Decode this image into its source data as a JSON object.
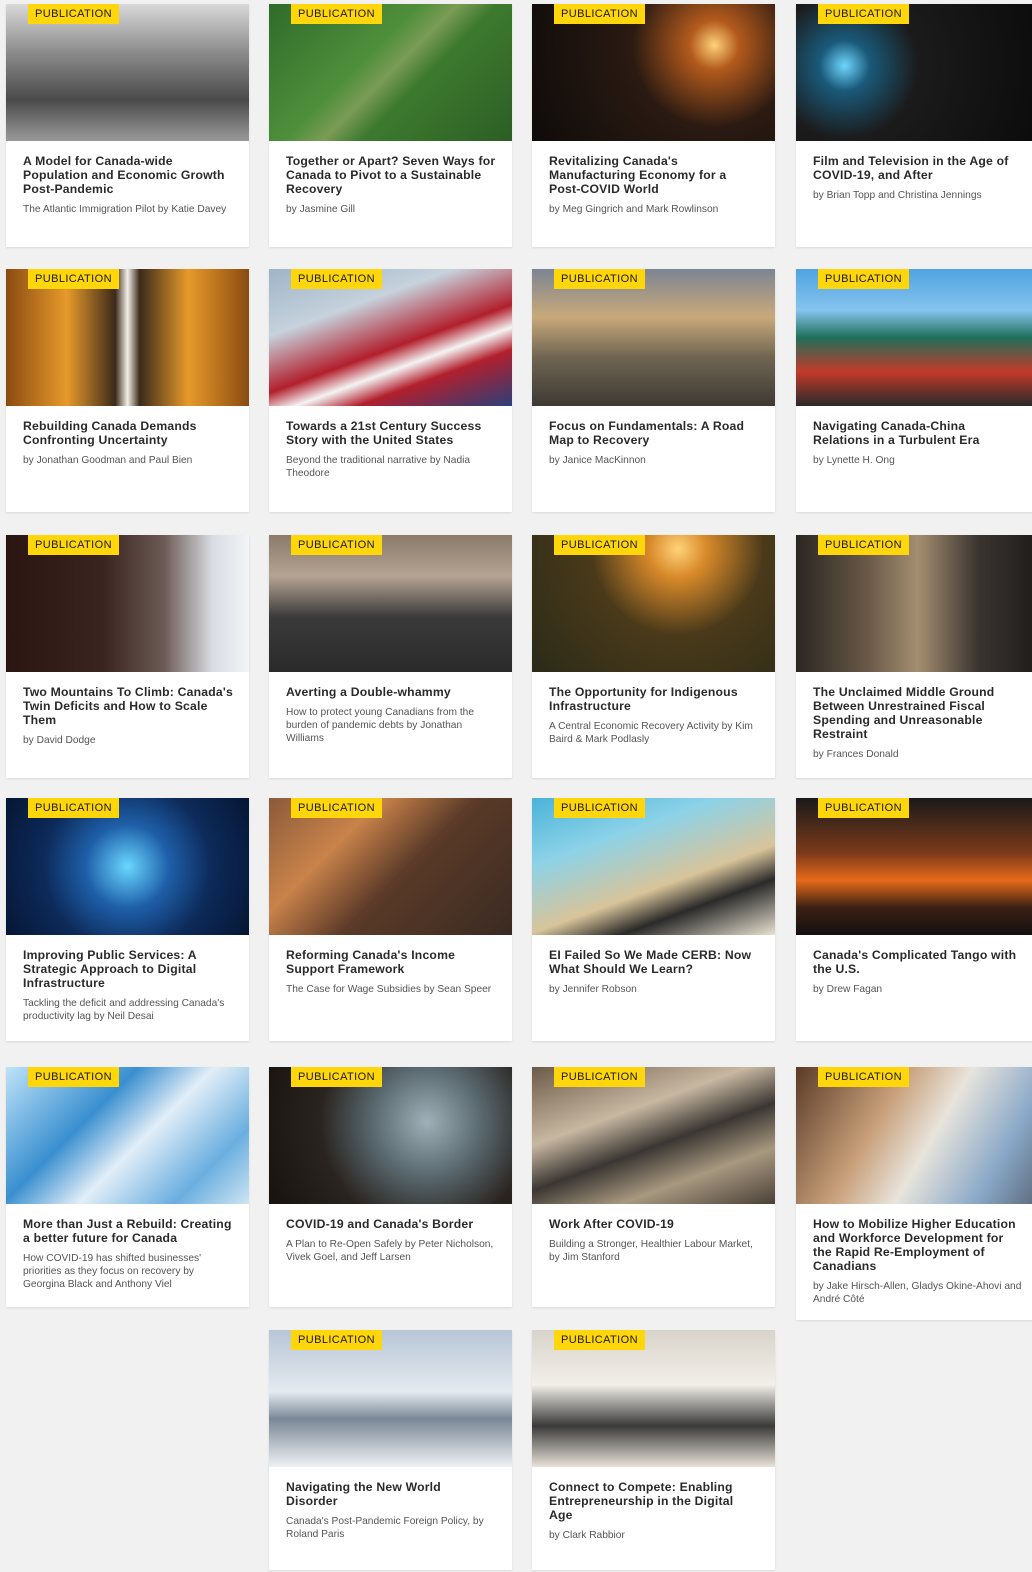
{
  "badge_label": "PUBLICATION",
  "cards": [
    {
      "title": "A Model for Canada-wide Population and Economic Growth Post-Pandemic",
      "sub": "The Atlantic Immigration Pilot by Katie Davey",
      "bg": "linear-gradient(180deg,#d9d9d9 0%,#8c8c8c 35%,#4a4a4a 70%,#9a9a9a 100%)"
    },
    {
      "title": "Together or Apart? Seven Ways for Canada to Pivot to a Sustainable Recovery",
      "sub": "by Jasmine Gill",
      "bg": "linear-gradient(135deg,#2f6b2a 0%,#4f8f3b 40%,#7a9b56 50%,#3d7a2e 60%,#2c5e25 100%)"
    },
    {
      "title": "Revitalizing Canada's Manufacturing Economy for a Post-COVID World",
      "sub": "by Meg Gingrich and Mark Rowlinson",
      "bg": "radial-gradient(circle at 75% 30%,#ffd27a 0%,#b35a1c 12%,#2a1a12 40%,#0e0b0a 100%)"
    },
    {
      "title": "Film and Television in the Age of COVID-19, and After",
      "sub": "by Brian Topp and Christina Jennings",
      "bg": "radial-gradient(circle at 20% 45%,#6fd6ff 0%,#1a5a7a 12%,#1b1b1b 35%,#0b0b0b 100%)"
    },
    {
      "title": "Rebuilding Canada Demands Confronting Uncertainty",
      "sub": "by Jonathan Goodman and Paul Bien",
      "bg": "linear-gradient(90deg,#8a4b12 0%,#e79a2a 25%,#3b2a1a 45%,#f3efe6 50%,#3b2a1a 55%,#e79a2a 75%,#8a4b12 100%)"
    },
    {
      "title": "Towards a 21st Century Success Story with the United States",
      "sub": "Beyond the traditional narrative by Nadia Theodore",
      "bg": "linear-gradient(160deg,#9fb4c8 0%,#c6d2dc 30%,#b21f2d 55%,#f4f4f4 65%,#b21f2d 75%,#2b3f7a 100%)"
    },
    {
      "title": "Focus on Fundamentals: A Road Map to Recovery",
      "sub": "by Janice MacKinnon",
      "bg": "linear-gradient(180deg,#7c8594 0%,#c9a97a 35%,#6e6452 65%,#3e3a33 100%)"
    },
    {
      "title": "Navigating Canada-China Relations in a Turbulent Era",
      "sub": "by Lynette H. Ong",
      "bg": "linear-gradient(180deg,#4fa3e0 0%,#86c4ee 30%,#1f6f5a 50%,#c23a2a 75%,#2a2a2a 100%)"
    },
    {
      "title": "Two Mountains To Climb: Canada's Twin Deficits and How to Scale Them",
      "sub": "by David Dodge",
      "bg": "linear-gradient(90deg,#2a1510 0%,#3a2420 40%,#6b5a55 65%,#d9dde3 85%,#f2f4f6 100%)"
    },
    {
      "title": "Averting a Double-whammy",
      "sub": "How to protect young Canadians from the burden of pandemic debts by Jonathan Williams",
      "bg": "linear-gradient(180deg,#8a7a6a 0%,#b5a493 30%,#3a3a3a 60%,#2a2a2a 100%)"
    },
    {
      "title": "The Opportunity for Indigenous Infrastructure",
      "sub": "A Central Economic Recovery Activity by Kim Baird & Mark Podlasly",
      "bg": "radial-gradient(circle at 60% 10%,#ffd37a 0%,#d98a2a 15%,#4a3a1a 45%,#2a2a18 100%)"
    },
    {
      "title": "The Unclaimed Middle Ground Between Unrestrained Fiscal Spending and Unreasonable Restraint",
      "sub": "by Frances Donald",
      "bg": "linear-gradient(90deg,#2a2622 0%,#6a5a48 30%,#a48e70 50%,#3a3430 75%,#1e1c1a 100%)"
    },
    {
      "title": "Improving Public Services: A Strategic Approach to Digital Infrastructure",
      "sub": "Tackling the deficit and addressing Canada's productivity lag by Neil Desai",
      "bg": "radial-gradient(circle at 50% 50%,#6ad7ff 0%,#1e5fa8 30%,#0d2a5a 60%,#061633 100%)"
    },
    {
      "title": "Reforming Canada's Income Support Framework",
      "sub": "The Case for Wage Subsidies by Sean Speer",
      "bg": "linear-gradient(135deg,#8a5a3a 0%,#c9834a 30%,#5a3a28 55%,#3a2a22 100%)"
    },
    {
      "title": "EI Failed So We Made CERB: Now What Should We Learn?",
      "sub": "by Jennifer Robson",
      "bg": "linear-gradient(160deg,#4ab3d8 0%,#8cd2e8 30%,#d8c49a 60%,#2a2a2a 75%,#e8e2d0 100%)"
    },
    {
      "title": "Canada's Complicated Tango with the U.S.",
      "sub": "by Drew Fagan",
      "bg": "linear-gradient(180deg,#1a1a1a 0%,#7a3a1a 40%,#e86a1a 60%,#3a2014 80%,#141010 100%)"
    },
    {
      "title": "More than Just a Rebuild: Creating a better future for Canada",
      "sub": "How COVID-19 has shifted businesses' priorities as they focus on recovery by Georgina Black and Anthony Viel",
      "bg": "linear-gradient(135deg,#bfe3f7 0%,#3a8fd0 35%,#e2eef7 55%,#6aaee0 80%,#cfe5f3 100%)"
    },
    {
      "title": "COVID-19 and Canada's Border",
      "sub": "A Plan to Re-Open Safely by Peter Nicholson, Vivek Goel, and Jeff Larsen",
      "bg": "radial-gradient(circle at 65% 40%,#9fb0b8 0%,#5a6a70 30%,#2a2420 60%,#18120e 100%)"
    },
    {
      "title": "Work After COVID-19",
      "sub": "Building a Stronger, Healthier Labour Market, by Jim Stanford",
      "bg": "linear-gradient(160deg,#6a5a48 0%,#c8b8a2 35%,#3a3632 55%,#a89880 75%,#4a4038 100%)"
    },
    {
      "title": "How to Mobilize Higher Education and Workforce Development for the Rapid Re-Employment of Canadians",
      "sub": "by Jake Hirsch-Allen, Gladys Okine-Ahovi and André Côté",
      "bg": "linear-gradient(120deg,#5a3a28 0%,#c8a07a 35%,#e8e4dc 55%,#8aa8c8 80%,#5a6a7a 100%)"
    },
    {
      "title": "Navigating the New World Disorder",
      "sub": "Canada's Post-Pandemic Foreign Policy, by Roland Paris",
      "bg": "linear-gradient(180deg,#b8c6d6 0%,#e4eaf0 45%,#7a8896 65%,#eef1f4 100%)"
    },
    {
      "title": "Connect to Compete: Enabling Entrepreneurship in the Digital Age",
      "sub": "by Clark Rabbior",
      "bg": "linear-gradient(180deg,#d8d4cc 0%,#f2efe8 40%,#3a3a3a 70%,#e8e2d8 100%)"
    }
  ]
}
